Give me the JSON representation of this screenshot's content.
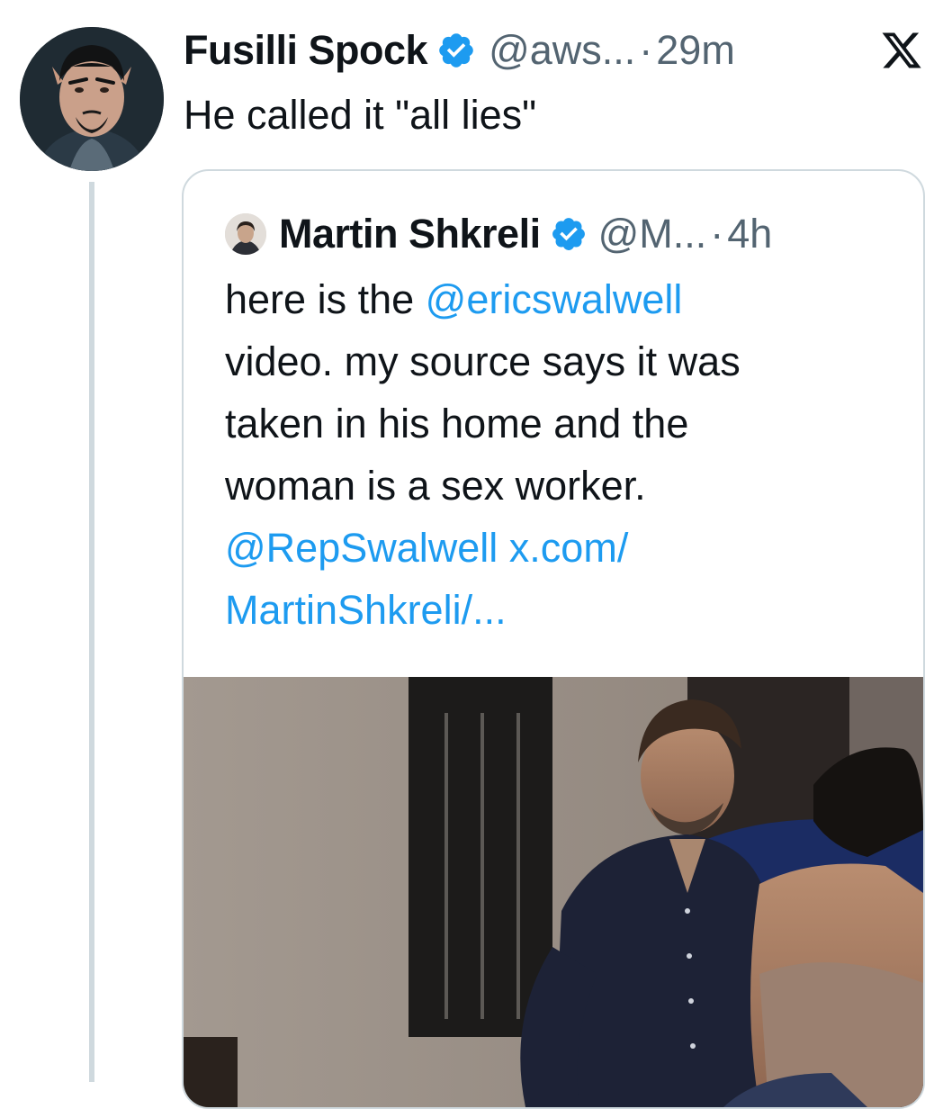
{
  "tweet": {
    "author_name": "Fusilli Spock",
    "handle": "@aws...",
    "separator": "·",
    "time": "29m",
    "text": "He called it \"all lies\"",
    "avatar_icon": "spock-avatar",
    "verified_icon": "verified-badge-icon",
    "close_icon": "x-logo-icon"
  },
  "quote": {
    "author_name": "Martin Shkreli",
    "handle": "@M...",
    "separator": "·",
    "time": "4h",
    "avatar_icon": "martin-shkreli-avatar",
    "verified_icon": "verified-badge-icon",
    "body": {
      "part1": "here is the ",
      "mention1": "@ericswalwell",
      "line2": "video. my source says it was",
      "line3": "taken in his home and the",
      "line4": "woman is a sex worker.",
      "mention2": "@RepSwalwell",
      "url_part1": " x.com/",
      "url_part2": "MartinShkreli/..."
    },
    "media_icon": "video-thumbnail"
  },
  "colors": {
    "text": "#0f1419",
    "secondary": "#536471",
    "link": "#1d9bf0",
    "border": "#cfd9de",
    "verified": "#1d9bf0"
  }
}
